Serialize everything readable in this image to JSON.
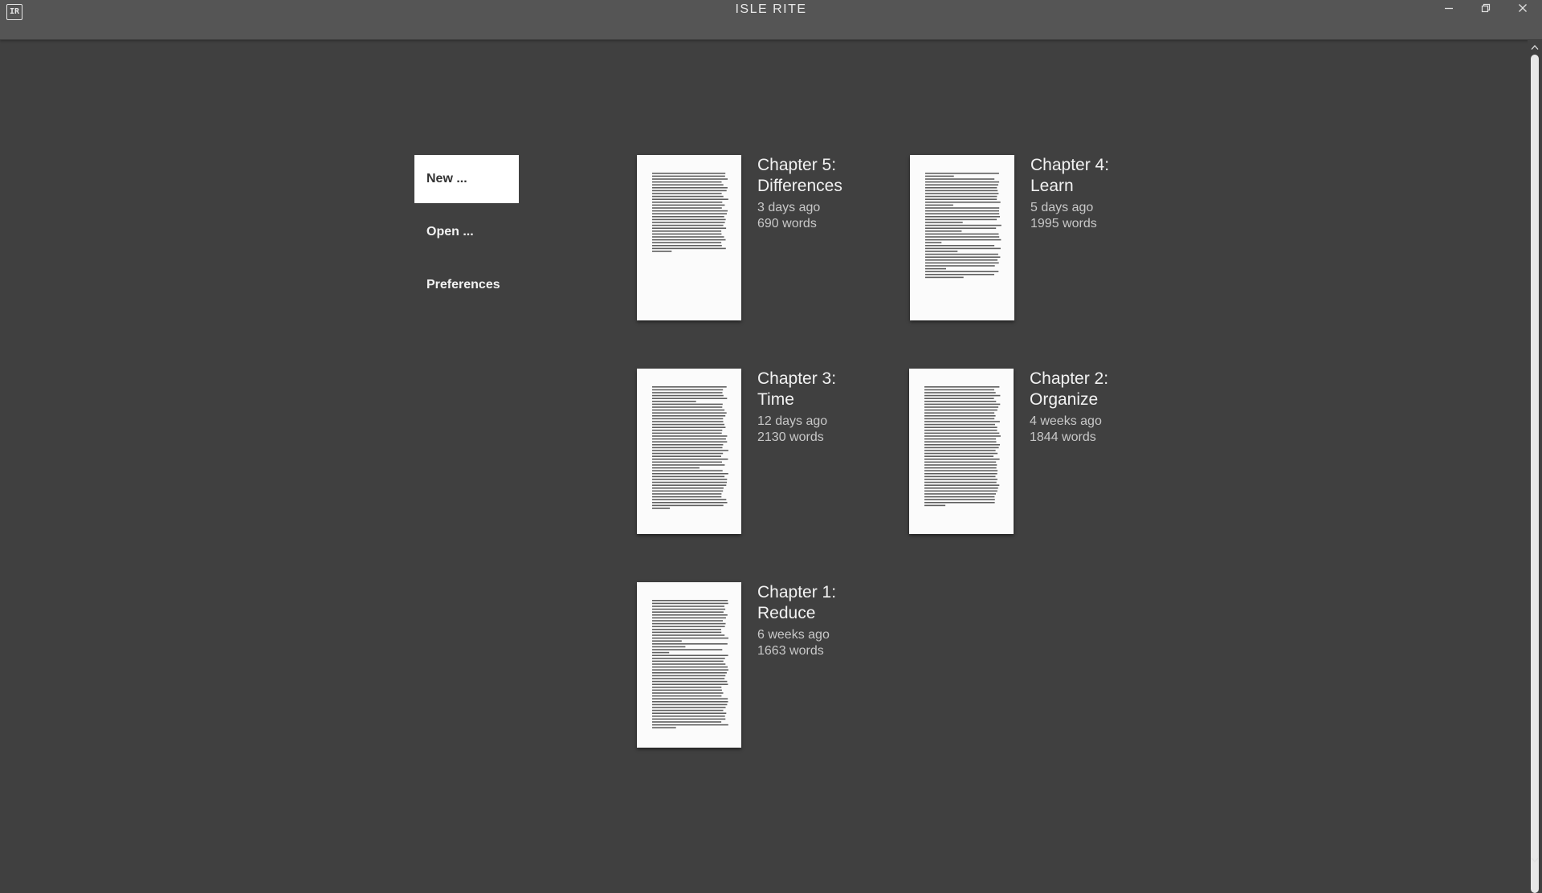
{
  "window": {
    "title": "ISLE RITE",
    "logo_text": "IR"
  },
  "menu": {
    "items": [
      {
        "label": "New ...",
        "active": true
      },
      {
        "label": "Open ..."
      },
      {
        "label": "Preferences"
      }
    ]
  },
  "documents": [
    {
      "title": "Chapter 5:\nDifferences",
      "modified": "3 days ago",
      "words": "690 words"
    },
    {
      "title": "Chapter 4:\nLearn",
      "modified": "5 days ago",
      "words": "1995 words"
    },
    {
      "title": "Chapter 3:\nTime",
      "modified": "12 days ago",
      "words": "2130 words"
    },
    {
      "title": "Chapter 2:\nOrganize",
      "modified": "4 weeks ago",
      "words": "1844 words"
    },
    {
      "title": "Chapter 1:\nReduce",
      "modified": "6 weeks ago",
      "words": "1663 words"
    }
  ],
  "icons": {
    "minimize": "minimize-icon",
    "maximize": "restore-icon",
    "close": "close-icon",
    "scroll_up": "chevron-up-icon",
    "scroll_down": "chevron-down-icon"
  },
  "colors": {
    "background": "#404040",
    "titlebar": "#555555",
    "text": "#f2f2f2",
    "meta_text": "#c8c8c8",
    "active_menu_bg": "#ffffff"
  }
}
